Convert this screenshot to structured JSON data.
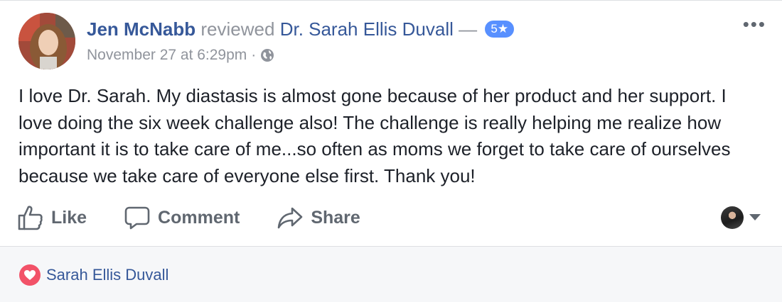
{
  "post": {
    "author": "Jen McNabb",
    "verb": "reviewed",
    "page_name": "Dr. Sarah Ellis Duvall",
    "dash": "—",
    "rating_label": "5★",
    "timestamp": "November 27 at 6:29pm",
    "separator": "·",
    "privacy_icon": "globe-icon",
    "more_icon": "•••",
    "text": "I love Dr. Sarah. My diastasis is almost gone because of her product and her support. I love doing the six week challenge also! The challenge is really helping me realize how important it is to take care of me...so often as moms we forget to take care of ourselves because we take care of everyone else first. Thank you!"
  },
  "actions": {
    "like_label": "Like",
    "comment_label": "Comment",
    "share_label": "Share"
  },
  "reactions": {
    "reaction_icon": "heart-icon",
    "names": "Sarah Ellis Duvall"
  },
  "colors": {
    "link": "#365899",
    "muted": "#90949c",
    "badge": "#5890ff",
    "heart": "#f25268"
  }
}
